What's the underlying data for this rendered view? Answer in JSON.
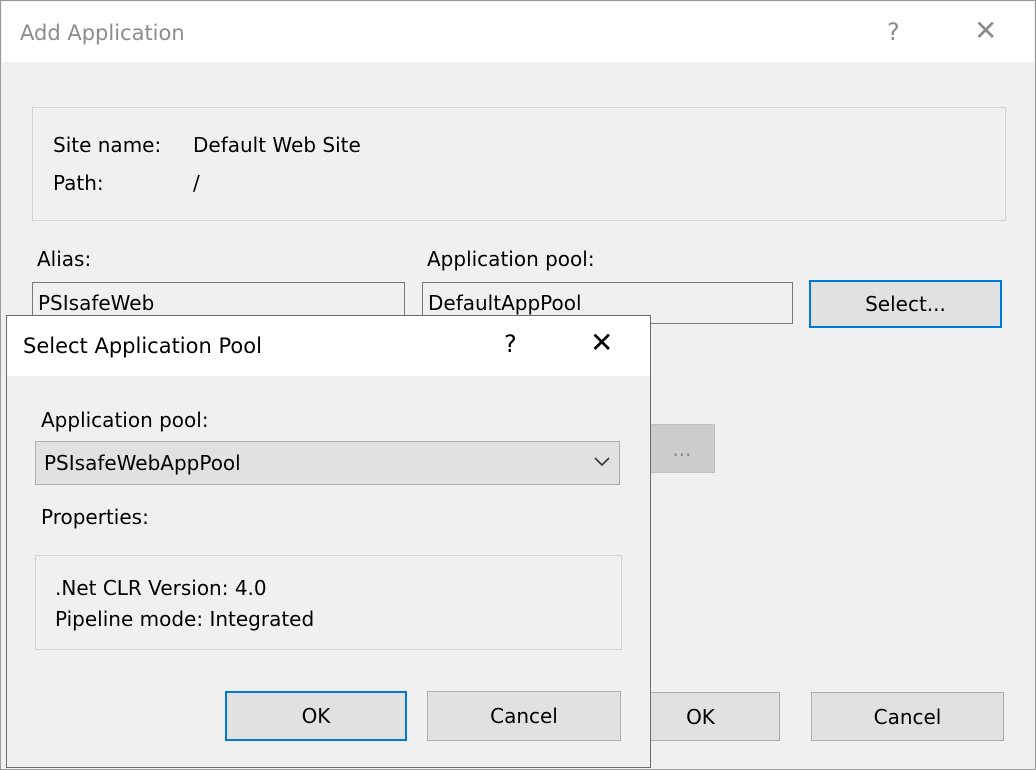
{
  "outer_dialog": {
    "title": "Add Application",
    "help_glyph": "?",
    "close_glyph": "✕",
    "site_name_label": "Site name:",
    "site_name_value": "Default Web Site",
    "path_label": "Path:",
    "path_value": "/",
    "alias_label": "Alias:",
    "alias_value": "PSIsafeWeb",
    "app_pool_label": "Application pool:",
    "app_pool_value": "DefaultAppPool",
    "select_button": "Select...",
    "browse_button": "...",
    "ok_button": "OK",
    "cancel_button": "Cancel"
  },
  "inner_dialog": {
    "title": "Select Application Pool",
    "help_glyph": "?",
    "close_glyph": "✕",
    "app_pool_label": "Application pool:",
    "app_pool_selected": "PSIsafeWebAppPool",
    "properties_label": "Properties:",
    "clr_version": ".Net CLR Version: 4.0",
    "pipeline_mode": "Pipeline mode: Integrated",
    "ok_button": "OK",
    "cancel_button": "Cancel"
  },
  "colors": {
    "accent": "#0078d7",
    "button_face": "#e1e1e1",
    "dialog_bg": "#f0f0f0",
    "disabled_title": "#8c8c8c"
  },
  "icons": {
    "help": "question-mark-icon",
    "close": "close-icon",
    "dropdown": "chevron-down-icon"
  }
}
